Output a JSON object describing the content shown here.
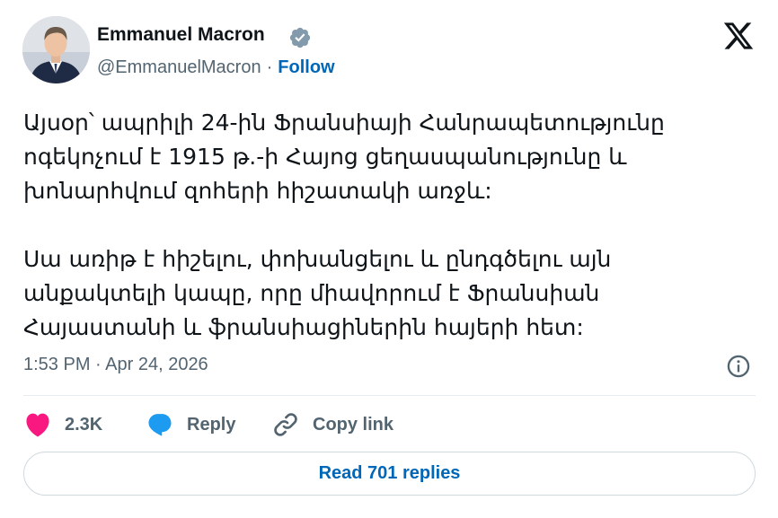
{
  "author": {
    "name": "Emmanuel Macron",
    "handle": "@EmmanuelMacron",
    "separator": "·",
    "follow_label": "Follow",
    "verified": true
  },
  "tweet": {
    "paragraphs": [
      "Այսօր՝ ապրիլի 24-ին Ֆրանսիայի Հանրապետությունը ոգեկոչում է 1915 թ.-ի Հայոց ցեղասպանությունը և խոնարհվում զոհերի հիշատակի առջև:",
      "Սա առիթ է հիշելու, փոխանցելու և ընդգծելու այն անքակտելի կապը, որը միավորում է Ֆրանսիան Հայաստանի և ֆրանսիացիներին հայերի հետ:"
    ],
    "timestamp": "1:53 PM · Apr 24, 2026"
  },
  "actions": {
    "like_count": "2.3K",
    "reply_label": "Reply",
    "copy_link_label": "Copy link"
  },
  "read_replies_label": "Read 701 replies",
  "colors": {
    "accent": "#0067b8",
    "like": "#f91880",
    "reply_icon": "#1d9bf0",
    "muted_text": "#536471",
    "text": "#0f1419",
    "verified_badge": "#829aab"
  },
  "icons": {
    "verified": "verified-badge-icon",
    "brand": "x-logo-icon",
    "info": "info-icon",
    "like": "heart-icon",
    "reply": "chat-bubble-icon",
    "copy_link": "link-icon"
  }
}
